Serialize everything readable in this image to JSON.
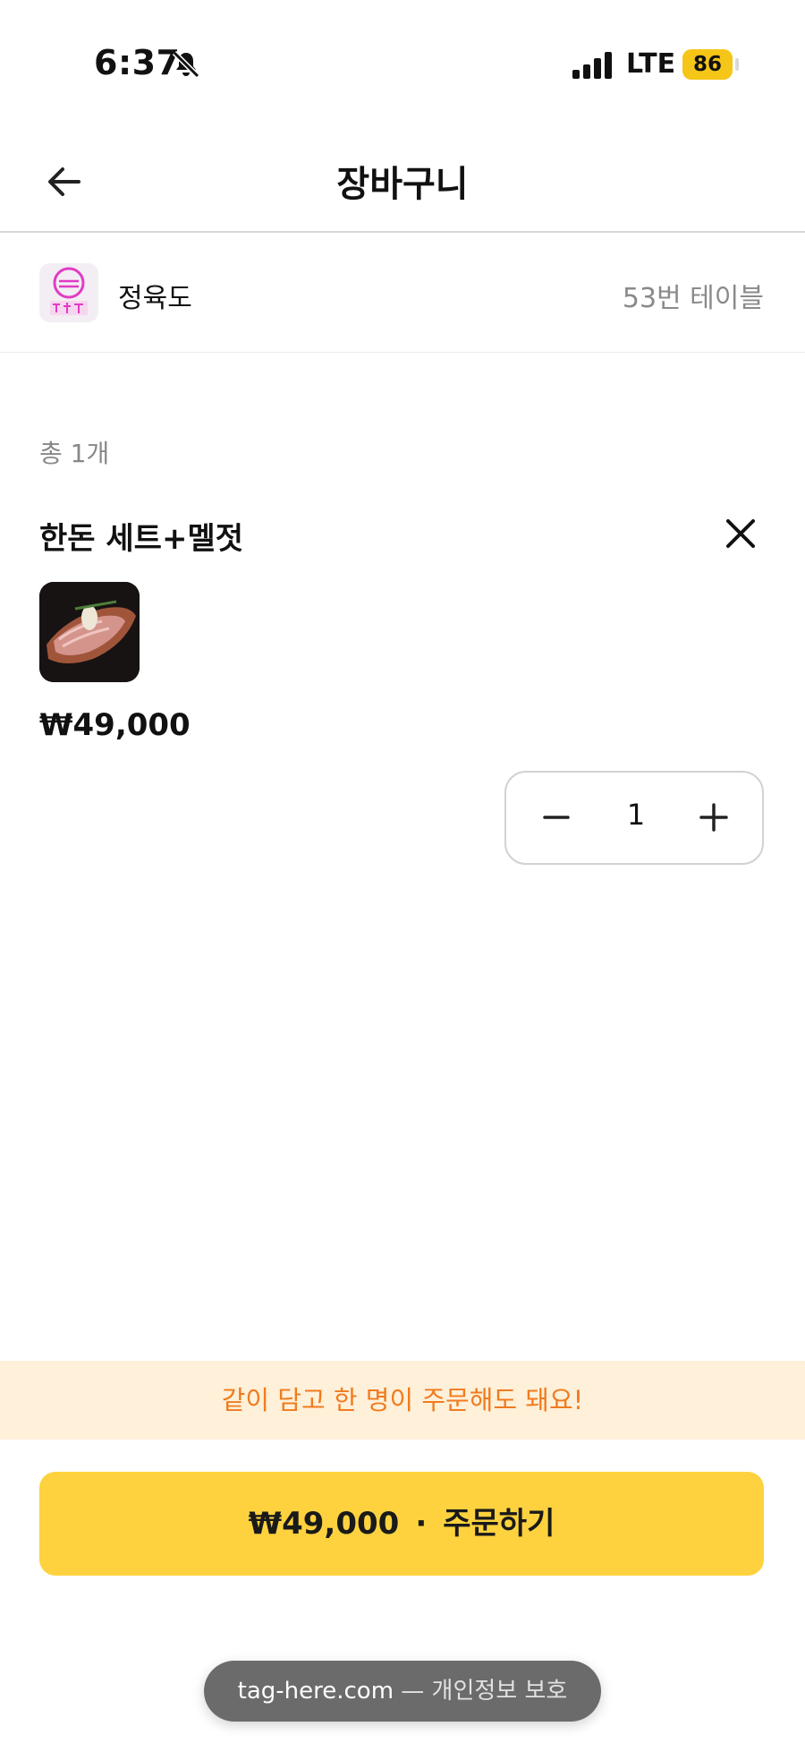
{
  "status_bar": {
    "time": "6:37",
    "network": "LTE",
    "battery": "86"
  },
  "header": {
    "title": "장바구니"
  },
  "store": {
    "name": "정육도",
    "table": "53번 테이블",
    "logo_text": "정육도"
  },
  "cart": {
    "total": "총 1개",
    "items": [
      {
        "name": "한돈 세트+멜젓",
        "price": "₩49,000",
        "quantity": "1"
      }
    ]
  },
  "banner": {
    "text": "같이 담고 한 명이 주문해도 돼요!"
  },
  "order_button": {
    "price": "₩49,000",
    "separator": "·",
    "label": "주문하기"
  },
  "url_bar": {
    "domain": "tag-here.com",
    "suffix": "— 개인정보 보호"
  },
  "colors": {
    "accent": "#fdd23e",
    "banner_bg": "#fff0d9",
    "banner_text": "#f07b1e",
    "battery": "#f5c518"
  }
}
